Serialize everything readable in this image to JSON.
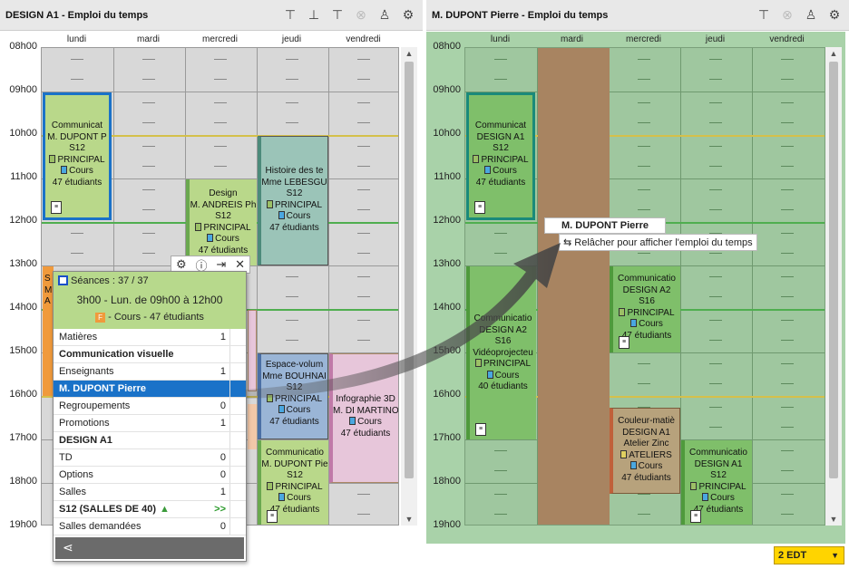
{
  "left_panel": {
    "title": "DESIGN A1 - Emploi du temps",
    "tools": [
      "filter-icon",
      "add-filter-icon",
      "remove-filter-icon",
      "cancel-icon",
      "user-icon",
      "gear-icon"
    ],
    "days": [
      "lundi",
      "mardi",
      "mercredi",
      "jeudi",
      "vendredi"
    ],
    "hours": [
      "08h00",
      "09h00",
      "10h00",
      "11h00",
      "12h00",
      "13h00",
      "14h00",
      "15h00",
      "16h00",
      "17h00",
      "18h00",
      "19h00"
    ],
    "courses": {
      "c1": {
        "l1": "Communicat",
        "l2": "M. DUPONT P",
        "l3": "S12",
        "l4": "PRINCIPAL",
        "l5": "Cours",
        "l6": "47 étudiants"
      },
      "c2": {
        "l1": "Design",
        "l2": "M. ANDREIS Ph",
        "l3": "S12",
        "l4": "PRINCIPAL",
        "l5": "Cours",
        "l6": "47 étudiants"
      },
      "c3": {
        "l1": "Histoire des te",
        "l2": "Mme LEBESGU",
        "l3": "S12",
        "l4": "PRINCIPAL",
        "l5": "Cours",
        "l6": "47 étudiants"
      },
      "c4": {
        "l1": "Espace-volum",
        "l2": "Mme BOUHNAI",
        "l3": "S12",
        "l4": "PRINCIPAL",
        "l5": "Cours",
        "l6": "47 étudiants"
      },
      "c5": {
        "l1": "Infographie 3D",
        "l2": "M. DI MARTINO",
        "l3": "Cours",
        "l4": "47 étudiants"
      },
      "c6": {
        "l1": "Communicatio",
        "l2": "M. DUPONT Pie",
        "l3": "S12",
        "l4": "PRINCIPAL",
        "l5": "Cours",
        "l6": "47 étudiants"
      },
      "c7": {
        "l1": "S",
        "l2": "M",
        "l3": "A"
      }
    }
  },
  "popup": {
    "sessions": "Séances : 37 / 37",
    "time": "3h00 - Lun. de 09h00 à 12h00",
    "type_badge": "F",
    "type": "- Cours - 47 étudiants",
    "rows": [
      {
        "label": "Matières",
        "value": "1"
      },
      {
        "label": "Communication visuelle",
        "value": ""
      },
      {
        "label": "Enseignants",
        "value": "1"
      },
      {
        "label": "M. DUPONT Pierre",
        "value": ""
      },
      {
        "label": "Regroupements",
        "value": "0"
      },
      {
        "label": "Promotions",
        "value": "1"
      },
      {
        "label": "DESIGN A1",
        "value": ""
      },
      {
        "label": "TD",
        "value": "0"
      },
      {
        "label": "Options",
        "value": "0"
      },
      {
        "label": "Salles",
        "value": "1"
      },
      {
        "label": "S12 (SALLES DE 40)",
        "value": ">>"
      },
      {
        "label": "Salles demandées",
        "value": "0"
      }
    ]
  },
  "right_panel": {
    "title": "M. DUPONT Pierre - Emploi du temps",
    "tools": [
      "filter-icon",
      "cancel-icon",
      "user-icon",
      "gear-icon"
    ],
    "days": [
      "lundi",
      "mardi",
      "mercredi",
      "jeudi",
      "vendredi"
    ],
    "hours": [
      "08h00",
      "09h00",
      "10h00",
      "11h00",
      "12h00",
      "13h00",
      "14h00",
      "15h00",
      "16h00",
      "17h00",
      "18h00",
      "19h00"
    ],
    "courses": {
      "r1": {
        "l1": "Communicat",
        "l2": "DESIGN A1",
        "l3": "S12",
        "l4": "PRINCIPAL",
        "l5": "Cours",
        "l6": "47 étudiants"
      },
      "r2": {
        "l1": "Communicatio",
        "l2": "DESIGN A2",
        "l3": "S16",
        "l4": "Vidéoprojecteu",
        "l5": "PRINCIPAL",
        "l6": "Cours",
        "l7": "40 étudiants"
      },
      "r3": {
        "l1": "Communicatio",
        "l2": "DESIGN A2",
        "l3": "S16",
        "l4": "PRINCIPAL",
        "l5": "Cours",
        "l6": "47 étudiants"
      },
      "r4": {
        "l1": "Couleur-matiè",
        "l2": "DESIGN A1",
        "l3": "Atelier Zinc",
        "l4": "ATELIERS",
        "l5": "Cours",
        "l6": "47 étudiants"
      },
      "r5": {
        "l1": "Communicatio",
        "l2": "DESIGN A1",
        "l3": "S12",
        "l4": "PRINCIPAL",
        "l5": "Cours",
        "l6": "47 étudiants"
      }
    },
    "drag_tip_title": "M. DUPONT Pierre",
    "drag_tip": "Relâcher pour afficher l'emploi du temps",
    "edt_badge": "2 EDT"
  },
  "colors": {
    "selected": "#1a72c8",
    "green_course": "#b9d88a",
    "blue_course": "#9ab5d6",
    "pink_course": "#e7c6da",
    "orange": "#f09a3c",
    "teal": "#9bc4b8"
  }
}
